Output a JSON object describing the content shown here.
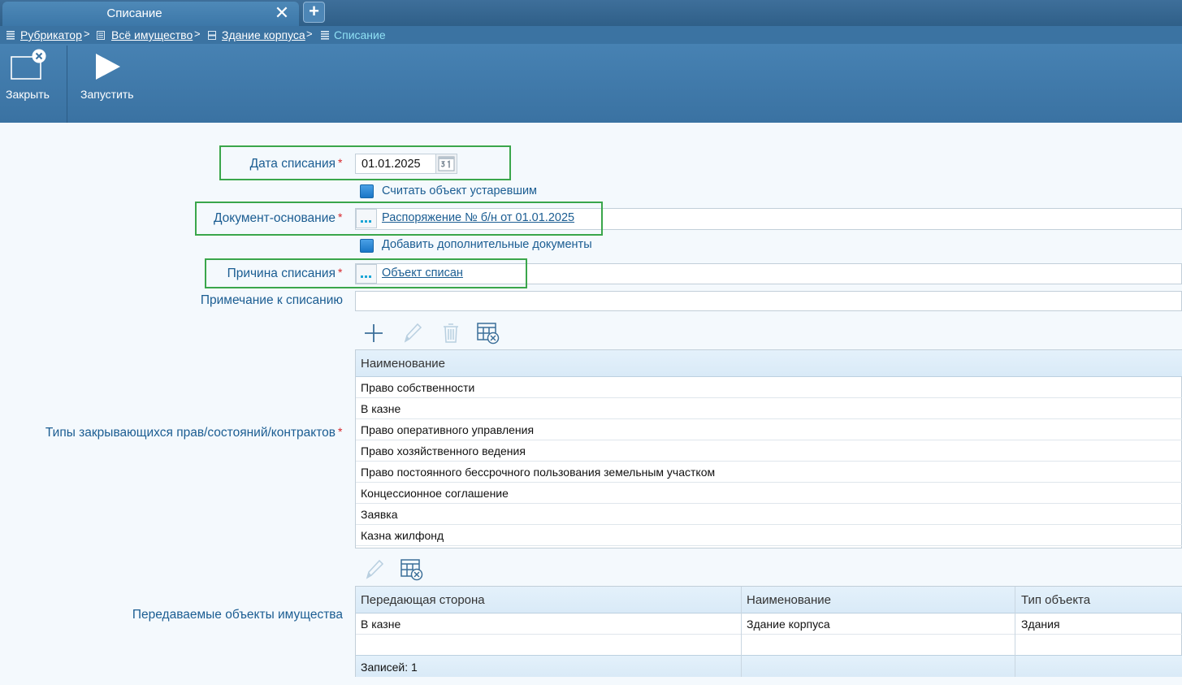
{
  "tab": {
    "title": "Списание",
    "close_glyph": "✕",
    "add_glyph": "+"
  },
  "breadcrumb": {
    "items": [
      {
        "label": "Рубрикатор",
        "icon": "list-icon"
      },
      {
        "label": "Всё имущество",
        "icon": "book-icon"
      },
      {
        "label": "Здание корпуса",
        "icon": "building-icon"
      }
    ],
    "separator": ">",
    "current": "Списание"
  },
  "toolbar": {
    "close_label": "Закрыть",
    "run_label": "Запустить"
  },
  "form": {
    "writeoff_date": {
      "label": "Дата списания",
      "value": "01.01.2025",
      "required": "*"
    },
    "obsolete_checkbox": {
      "label": "Считать объект устаревшим"
    },
    "basis_document": {
      "label": "Документ-основание",
      "value": "Распоряжение № б/н от 01.01.2025",
      "required": "*"
    },
    "add_docs_checkbox": {
      "label": "Добавить дополнительные документы"
    },
    "reason": {
      "label": "Причина списания",
      "value": "Объект списан",
      "required": "*"
    },
    "note": {
      "label": "Примечание к списанию",
      "value": ""
    },
    "rights_types": {
      "label": "Типы закрывающихся прав/состояний/контрактов",
      "required": "*",
      "column": "Наименование",
      "rows": [
        "Право собственности",
        "В казне",
        "Право оперативного управления",
        "Право хозяйственного ведения",
        "Право постоянного бессрочного пользования земельным участком",
        "Концессионное соглашение",
        "Заявка",
        "Казна жилфонд"
      ]
    },
    "objects": {
      "label": "Передаваемые объекты имущества",
      "columns": [
        "Передающая сторона",
        "Наименование",
        "Тип объекта"
      ],
      "rows": [
        [
          "В казне",
          "Здание корпуса",
          "Здания"
        ]
      ],
      "footer": "Записей: 1"
    }
  },
  "colors": {
    "accent": "#1b5d92",
    "highlight": "#3aa64b",
    "header_bg": "#3b73a2",
    "required": "#d7262b"
  }
}
